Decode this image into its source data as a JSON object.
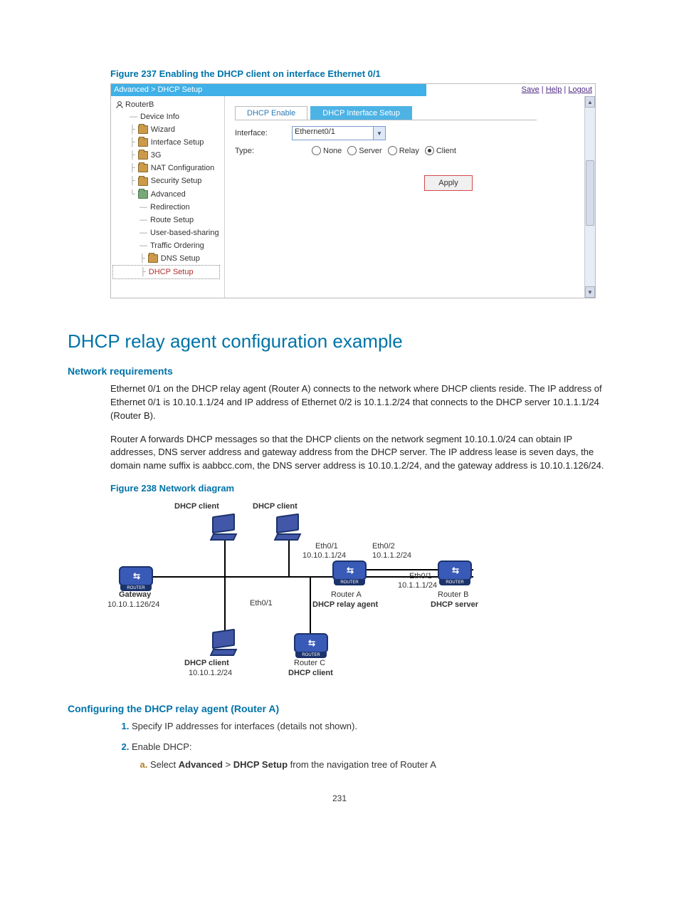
{
  "figure237_caption": "Figure 237 Enabling the DHCP client on interface Ethernet 0/1",
  "shot": {
    "breadcrumb": "Advanced > DHCP Setup",
    "links": {
      "save": "Save",
      "help": "Help",
      "logout": "Logout"
    },
    "nav": {
      "root": "RouterB",
      "items": [
        "Device Info",
        "Wizard",
        "Interface Setup",
        "3G",
        "NAT Configuration",
        "Security Setup",
        "Advanced",
        "Redirection",
        "Route Setup",
        "User-based-sharing",
        "Traffic Ordering",
        "DNS Setup",
        "DHCP Setup"
      ]
    },
    "tabs": {
      "enable": "DHCP Enable",
      "iface": "DHCP Interface Setup"
    },
    "form": {
      "interface_label": "Interface:",
      "interface_value": "Ethernet0/1",
      "type_label": "Type:",
      "radios": {
        "none": "None",
        "server": "Server",
        "relay": "Relay",
        "client": "Client"
      },
      "apply": "Apply"
    }
  },
  "h1": "DHCP relay agent configuration example",
  "netreq_h": "Network requirements",
  "netreq_p1": "Ethernet 0/1 on the DHCP relay agent (Router A) connects to the network where DHCP clients reside. The IP address of Ethernet 0/1 is 10.10.1.1/24 and IP address of Ethernet 0/2 is 10.1.1.2/24 that connects to the DHCP server 10.1.1.1/24 (Router B).",
  "netreq_p2": "Router A forwards DHCP messages so that the DHCP clients on the network segment 10.10.1.0/24 can obtain IP addresses, DNS server address and gateway address from the DHCP server. The IP address lease is seven days, the domain name suffix is aabbcc.com, the DNS server address is 10.10.1.2/24, and the gateway address is 10.10.1.126/24.",
  "figure238_caption": "Figure 238 Network diagram",
  "diagram": {
    "dhcp_client": "DHCP client",
    "gateway": "Gateway",
    "gateway_ip": "10.10.1.126/24",
    "eth01": "Eth0/1",
    "eth02": "Eth0/2",
    "ip_a1": "10.10.1.1/24",
    "ip_a2": "10.1.1.2/24",
    "ip_b1": "10.1.1.1/24",
    "routerA": "Router A",
    "routerA_role": "DHCP relay agent",
    "routerB": "Router B",
    "routerB_role": "DHCP server",
    "routerC": "Router C",
    "routerC_role": "DHCP client",
    "client_ip": "10.10.1.2/24"
  },
  "config_h": "Configuring the DHCP relay agent (Router A)",
  "steps": {
    "s1": "Specify IP addresses for interfaces (details not shown).",
    "s2": "Enable DHCP:",
    "s2a_pre": "Select ",
    "s2a_adv": "Advanced",
    "s2a_mid": " > ",
    "s2a_dhcp": "DHCP Setup",
    "s2a_post": " from the navigation tree of Router A"
  },
  "page_number": "231"
}
